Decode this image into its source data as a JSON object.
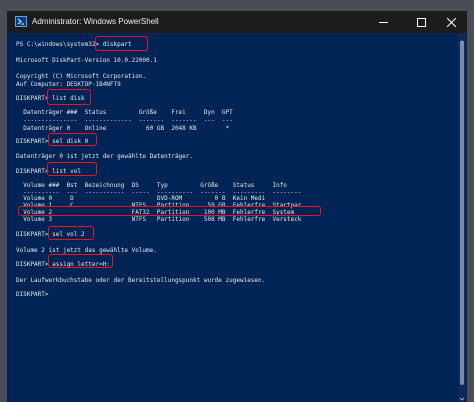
{
  "window": {
    "title": "Administrator: Windows PowerShell"
  },
  "terminal": {
    "lines": [
      "PS C:\\windows\\system32> diskpart",
      "",
      "Microsoft DiskPart-Version 10.0.22000.1",
      "",
      "Copyright (C) Microsoft Corporation.",
      "Auf Computer: DESKTOP-1B4NFT9",
      "",
      "DISKPART> list disk",
      "",
      "  Datenträger ###  Status         Größe    Frei     Dyn  GPT",
      "  ---------------  -------------  -------  -------  ---  ---",
      "  Datenträger 0    Online           60 GB  2048 KB        *",
      "",
      "DISKPART> sel disk 0",
      "",
      "Datenträger 0 ist jetzt der gewählte Datenträger.",
      "",
      "DISKPART> list vol",
      "",
      "  Volume ###  Bst  Bezeichnung  DS     Typ         Größe    Status     Info",
      "  ----------  ---  -----------  -----  ----------  -------  ---------  --------",
      "  Volume 0     D                       DVD-ROM         0 B  Kein Medi",
      "  Volume 1     C                NTFS   Partition     59 GB  Fehlerfre  Startpar",
      "  Volume 2                      FAT32  Partition    100 MB  Fehlerfre  System",
      "  Volume 3                      NTFS   Partition    508 MB  Fehlerfre  Versteck",
      "",
      "DISKPART> sel vol 2",
      "",
      "Volume 2 ist jetzt das gewählte Volume.",
      "",
      "DISKPART> assign letter=H:",
      "",
      "Der Laufwerkbuchstabe oder der Bereitstellungspunkt wurde zugewiesen.",
      "",
      "DISKPART>"
    ]
  },
  "colors": {
    "terminal_background": "#012456",
    "terminal_text": "#e8e8e8",
    "highlight": "#e8141d",
    "titlebar": "#1c1c1c"
  },
  "icons": {
    "app": "powershell-icon",
    "minimize": "minimize-icon",
    "maximize": "maximize-icon",
    "close": "close-icon"
  }
}
